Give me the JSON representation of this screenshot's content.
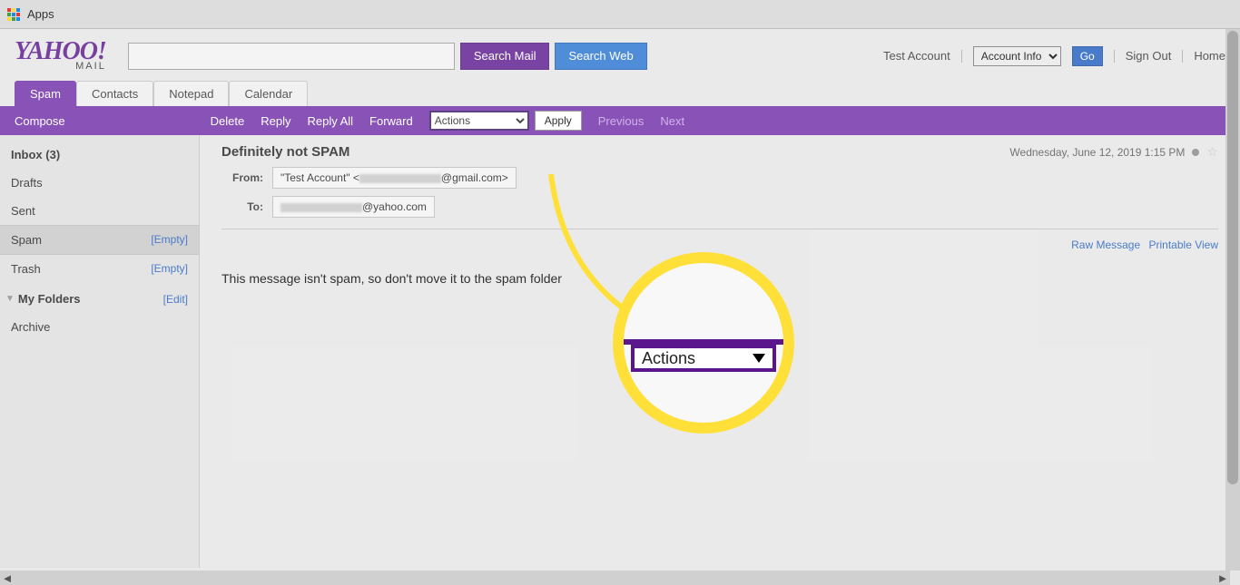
{
  "browser": {
    "apps_label": "Apps"
  },
  "logo": {
    "brand": "YAHOO!",
    "sub": "MAIL"
  },
  "search": {
    "value": "",
    "search_mail": "Search Mail",
    "search_web": "Search Web"
  },
  "topnav": {
    "test_account": "Test Account",
    "account_info": "Account Info",
    "go": "Go",
    "sign_out": "Sign Out",
    "home": "Home"
  },
  "tabs": {
    "spam": "Spam",
    "contacts": "Contacts",
    "notepad": "Notepad",
    "calendar": "Calendar"
  },
  "toolbar": {
    "compose": "Compose",
    "delete": "Delete",
    "reply": "Reply",
    "reply_all": "Reply All",
    "forward": "Forward",
    "actions": "Actions",
    "apply": "Apply",
    "previous": "Previous",
    "next": "Next"
  },
  "sidebar": {
    "inbox": "Inbox (3)",
    "drafts": "Drafts",
    "sent": "Sent",
    "spam": "Spam",
    "spam_action": "[Empty]",
    "trash": "Trash",
    "trash_action": "[Empty]",
    "myfolders": "My Folders",
    "edit": "[Edit]",
    "archive": "Archive"
  },
  "message": {
    "subject": "Definitely not SPAM",
    "date": "Wednesday, June 12, 2019 1:15 PM",
    "from_label": "From:",
    "from_prefix": "\"Test Account\" <",
    "from_suffix": "@gmail.com>",
    "to_label": "To:",
    "to_suffix": "@yahoo.com",
    "raw": "Raw Message",
    "printable": "Printable View",
    "body": "This message isn't spam, so don't move it to the spam folder"
  },
  "callout": {
    "label": "Actions"
  }
}
